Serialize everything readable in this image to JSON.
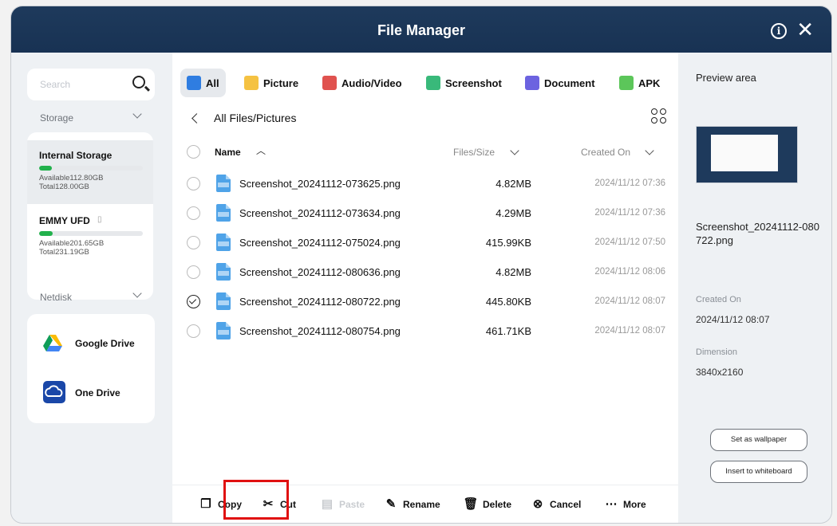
{
  "window": {
    "title": "File Manager"
  },
  "sidebar": {
    "search_placeholder": "Search",
    "storage_label": "Storage",
    "storages": [
      {
        "name": "Internal Storage",
        "available": "Available112.80GB",
        "total": "Total128.00GB",
        "used_fraction": 0.12,
        "selected": true
      },
      {
        "name": "EMMY UFD",
        "available": "Available201.65GB",
        "total": "Total231.19GB",
        "used_fraction": 0.13,
        "selected": false
      }
    ],
    "netdisk_label": "Netdisk",
    "netdisks": [
      {
        "name": "Google Drive",
        "icon": "google-drive-icon"
      },
      {
        "name": "One Drive",
        "icon": "onedrive-icon"
      }
    ]
  },
  "tabs": [
    {
      "label": "All",
      "icon": "folder-icon",
      "color": "#2f7de1",
      "active": true
    },
    {
      "label": "Picture",
      "icon": "picture-icon",
      "color": "#f5c242",
      "active": false
    },
    {
      "label": "Audio/Video",
      "icon": "audio-video-icon",
      "color": "#e0524f",
      "active": false
    },
    {
      "label": "Screenshot",
      "icon": "screenshot-icon",
      "color": "#39b97a",
      "active": false
    },
    {
      "label": "Document",
      "icon": "document-icon",
      "color": "#6c63e0",
      "active": false
    },
    {
      "label": "APK",
      "icon": "apk-icon",
      "color": "#5cc65a",
      "active": false
    }
  ],
  "breadcrumb": "All Files/Pictures",
  "table": {
    "col_name": "Name",
    "col_size": "Files/Size",
    "col_created": "Created On",
    "rows": [
      {
        "name": "Screenshot_20241112-073625.png",
        "size": "4.82MB",
        "date": "2024/11/12 07:36",
        "checked": false
      },
      {
        "name": "Screenshot_20241112-073634.png",
        "size": "4.29MB",
        "date": "2024/11/12 07:36",
        "checked": false
      },
      {
        "name": "Screenshot_20241112-075024.png",
        "size": "415.99KB",
        "date": "2024/11/12 07:50",
        "checked": false
      },
      {
        "name": "Screenshot_20241112-080636.png",
        "size": "4.82MB",
        "date": "2024/11/12 08:06",
        "checked": false
      },
      {
        "name": "Screenshot_20241112-080722.png",
        "size": "445.80KB",
        "date": "2024/11/12 08:07",
        "checked": true
      },
      {
        "name": "Screenshot_20241112-080754.png",
        "size": "461.71KB",
        "date": "2024/11/12 08:07",
        "checked": false
      }
    ]
  },
  "toolbar": {
    "copy": "Copy",
    "cut": "Cut",
    "paste": "Paste",
    "rename": "Rename",
    "delete": "Delete",
    "cancel": "Cancel",
    "more": "More"
  },
  "preview": {
    "title": "Preview area",
    "file_name": "Screenshot_20241112-080722.png",
    "created_label": "Created On",
    "created_value": "2024/11/12 08:07",
    "dimension_label": "Dimension",
    "dimension_value": "3840x2160",
    "set_wallpaper": "Set as wallpaper",
    "insert_whiteboard": "Insert to whiteboard"
  },
  "colors": {
    "titlebar": "#1e3a5c",
    "highlight": "#e01010",
    "storage_bar": "#22b14c",
    "file_icon": "#4fa3e8"
  }
}
